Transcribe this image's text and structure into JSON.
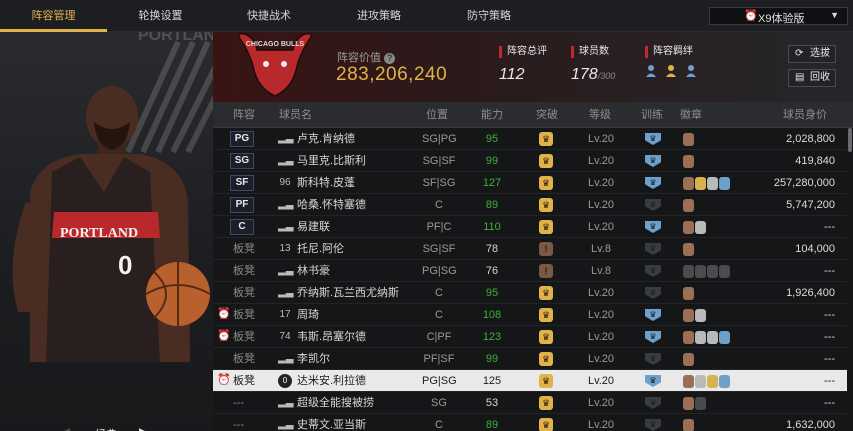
{
  "nav": {
    "tabs": [
      "阵容管理",
      "轮换设置",
      "快捷战术",
      "进攻策略",
      "防守策略"
    ],
    "active": 0,
    "version_label": "X9体验版",
    "version_icon": "alarm-clock-icon"
  },
  "left": {
    "mode_label": "经典",
    "jersey_text": "PORTLAND",
    "jersey_number": "0",
    "team_logo_text": "PORTLAND"
  },
  "summary": {
    "team_logo_text": "CHICAGO BULLS",
    "team_value_label": "阵容价值",
    "team_value": "283,206,240",
    "overall_label": "阵容总评",
    "overall": "112",
    "count_label": "球员数",
    "count": "178",
    "count_max": "/300",
    "bond_label": "阵容羁绊",
    "select_label": "选拔",
    "recycle_label": "回收"
  },
  "table": {
    "headers": [
      "阵容",
      "球员名",
      "位置",
      "能力",
      "突破",
      "等级",
      "训练",
      "徽章",
      "球员身价"
    ],
    "rows": [
      {
        "slot": "PG",
        "bench": false,
        "num": "",
        "name": "卢克.肯纳德",
        "pos": "SG|PG",
        "rating": "95",
        "green": true,
        "rank": "gold",
        "lv": "Lv.20",
        "train": "blue",
        "badges": [
          "br"
        ],
        "value": "2,028,800"
      },
      {
        "slot": "SG",
        "bench": false,
        "num": "",
        "name": "马里克.比斯利",
        "pos": "SG|SF",
        "rating": "99",
        "green": true,
        "rank": "gold",
        "lv": "Lv.20",
        "train": "blue",
        "badges": [
          "br"
        ],
        "value": "419,840"
      },
      {
        "slot": "SF",
        "bench": false,
        "num": "96",
        "name": "斯科特.皮蓬",
        "pos": "SF|SG",
        "rating": "127",
        "green": true,
        "rank": "gold",
        "lv": "Lv.20",
        "train": "blue",
        "badges": [
          "br",
          "go",
          "si",
          "bl"
        ],
        "value": "257,280,000"
      },
      {
        "slot": "PF",
        "bench": false,
        "num": "",
        "name": "哈桑.怀特塞德",
        "pos": "C",
        "rating": "89",
        "green": true,
        "rank": "gold",
        "lv": "Lv.20",
        "train": "dark",
        "badges": [
          "br"
        ],
        "value": "5,747,200"
      },
      {
        "slot": "C",
        "bench": false,
        "num": "",
        "name": "易建联",
        "pos": "PF|C",
        "rating": "110",
        "green": true,
        "rank": "gold",
        "lv": "Lv.20",
        "train": "blue",
        "badges": [
          "br",
          "si"
        ],
        "value": "---"
      },
      {
        "slot": "板凳",
        "bench": true,
        "num": "13",
        "name": "托尼.阿伦",
        "pos": "SG|SF",
        "rating": "78",
        "green": false,
        "rank": "brown",
        "lv": "Lv.8",
        "train": "dark",
        "badges": [
          "br"
        ],
        "value": "104,000"
      },
      {
        "slot": "板凳",
        "bench": true,
        "num": "",
        "name": "林书豪",
        "pos": "PG|SG",
        "rating": "76",
        "green": false,
        "rank": "brown",
        "lv": "Lv.8",
        "train": "dark",
        "badges": [
          "dk",
          "dk",
          "dk",
          "dk"
        ],
        "value": "---"
      },
      {
        "slot": "板凳",
        "bench": true,
        "num": "",
        "name": "乔纳斯.瓦兰西尤纳斯",
        "pos": "C",
        "rating": "95",
        "green": true,
        "rank": "gold",
        "lv": "Lv.20",
        "train": "dark",
        "badges": [
          "br"
        ],
        "value": "1,926,400"
      },
      {
        "slot": "板凳",
        "bench": true,
        "alarm": true,
        "num": "17",
        "name": "周琦",
        "pos": "C",
        "rating": "108",
        "green": true,
        "rank": "gold",
        "lv": "Lv.20",
        "train": "blue",
        "badges": [
          "br",
          "si"
        ],
        "value": "---"
      },
      {
        "slot": "板凳",
        "bench": true,
        "alarm": true,
        "num": "74",
        "name": "韦斯.昂塞尔德",
        "pos": "C|PF",
        "rating": "123",
        "green": true,
        "rank": "gold",
        "lv": "Lv.20",
        "train": "blue",
        "badges": [
          "br",
          "si",
          "si",
          "bl"
        ],
        "value": "---"
      },
      {
        "slot": "板凳",
        "bench": true,
        "num": "",
        "name": "李凯尔",
        "pos": "PF|SF",
        "rating": "99",
        "green": true,
        "rank": "gold",
        "lv": "Lv.20",
        "train": "dark",
        "badges": [
          "br"
        ],
        "value": "---"
      },
      {
        "slot": "板凳",
        "bench": true,
        "alarm": true,
        "selected": true,
        "num": "0",
        "name": "达米安.利拉德",
        "pos": "PG|SG",
        "rating": "125",
        "green": false,
        "rank": "gold",
        "lv": "Lv.20",
        "train": "blue",
        "badges": [
          "br",
          "si",
          "go",
          "bl"
        ],
        "value": "---"
      },
      {
        "slot": "---",
        "bench": true,
        "num": "",
        "name": "超级全能搜被捞",
        "pos": "SG",
        "rating": "53",
        "green": false,
        "rank": "gold",
        "lv": "Lv.20",
        "train": "dark",
        "badges": [
          "br",
          "dk"
        ],
        "value": "---"
      },
      {
        "slot": "---",
        "bench": true,
        "num": "",
        "name": "史蒂文.亚当斯",
        "pos": "C",
        "rating": "89",
        "green": true,
        "rank": "gold",
        "lv": "Lv.20",
        "train": "dark",
        "badges": [
          "br"
        ],
        "value": "1,632,000"
      }
    ]
  },
  "colors": {
    "accent": "#e2b24a",
    "green": "#3fae3a",
    "red": "#c0282c",
    "blue": "#6fa0c9"
  }
}
